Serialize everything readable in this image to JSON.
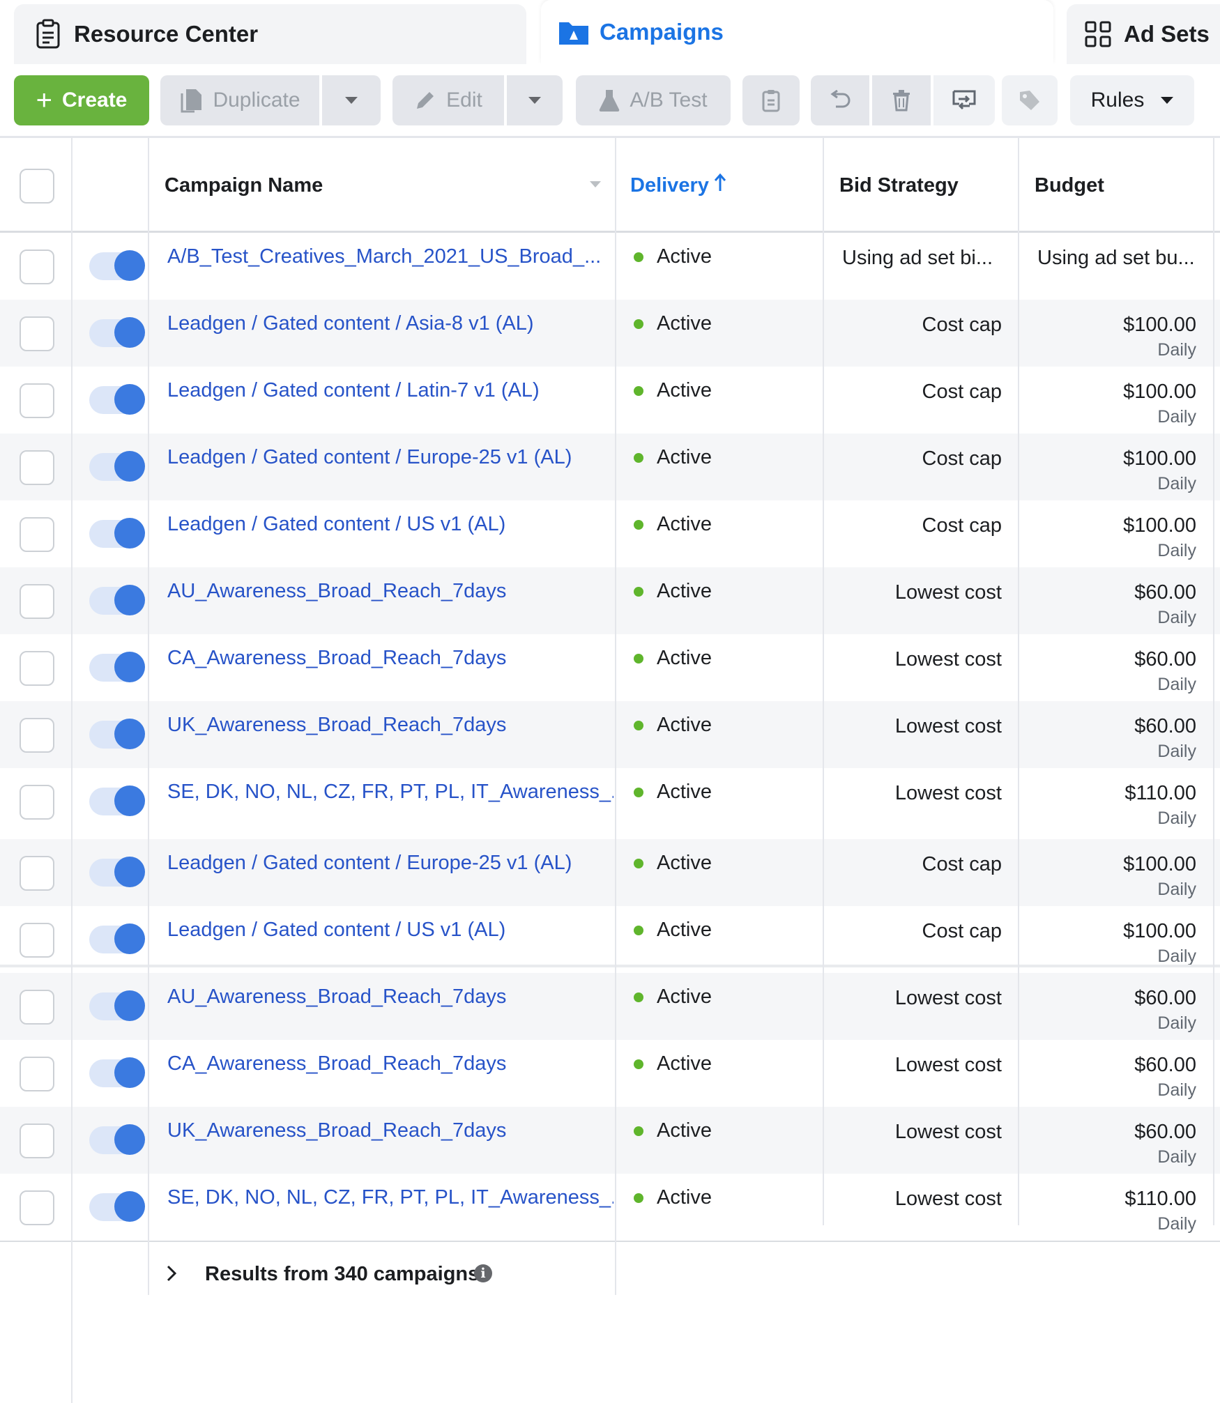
{
  "tabs": [
    {
      "label": "Resource Center",
      "icon": "clipboard-icon"
    },
    {
      "label": "Campaigns",
      "icon": "campaign-folder-icon",
      "active": true
    },
    {
      "label": "Ad Sets",
      "icon": "grid-icon"
    }
  ],
  "toolbar": {
    "create_label": "Create",
    "duplicate_label": "Duplicate",
    "edit_label": "Edit",
    "ab_test_label": "A/B Test",
    "rules_label": "Rules"
  },
  "colors": {
    "accent": "#1b74e4",
    "create_green": "#69b33e",
    "active_dot": "#5fb52c",
    "link_blue": "#2753c8"
  },
  "table": {
    "columns": {
      "name": "Campaign Name",
      "delivery": "Delivery",
      "bid": "Bid Strategy",
      "budget": "Budget"
    },
    "sort": {
      "column": "Delivery",
      "direction": "ascending"
    },
    "rows": [
      {
        "name": "A/B_Test_Creatives_March_2021_US_Broad_...",
        "delivery": "Active",
        "bid": "Using ad set bi...",
        "budget": "Using ad set bu...",
        "period": ""
      },
      {
        "name": "Leadgen / Gated content / Asia-8 v1 (AL)",
        "delivery": "Active",
        "bid": "Cost cap",
        "budget": "$100.00",
        "period": "Daily"
      },
      {
        "name": "Leadgen / Gated content / Latin-7 v1 (AL)",
        "delivery": "Active",
        "bid": "Cost cap",
        "budget": "$100.00",
        "period": "Daily"
      },
      {
        "name": "Leadgen / Gated content / Europe-25 v1 (AL)",
        "delivery": "Active",
        "bid": "Cost cap",
        "budget": "$100.00",
        "period": "Daily"
      },
      {
        "name": "Leadgen / Gated content / US v1 (AL)",
        "delivery": "Active",
        "bid": "Cost cap",
        "budget": "$100.00",
        "period": "Daily"
      },
      {
        "name": "AU_Awareness_Broad_Reach_7days",
        "delivery": "Active",
        "bid": "Lowest cost",
        "budget": "$60.00",
        "period": "Daily"
      },
      {
        "name": "CA_Awareness_Broad_Reach_7days",
        "delivery": "Active",
        "bid": "Lowest cost",
        "budget": "$60.00",
        "period": "Daily"
      },
      {
        "name": "UK_Awareness_Broad_Reach_7days",
        "delivery": "Active",
        "bid": "Lowest cost",
        "budget": "$60.00",
        "period": "Daily"
      },
      {
        "name": "SE, DK, NO, NL, CZ, FR, PT, PL, IT_Awareness_...",
        "delivery": "Active",
        "bid": "Lowest cost",
        "budget": "$110.00",
        "period": "Daily"
      },
      {
        "name": "Leadgen / Gated content / Europe-25 v1 (AL)",
        "delivery": "Active",
        "bid": "Cost cap",
        "budget": "$100.00",
        "period": "Daily"
      },
      {
        "name": "Leadgen / Gated content / US v1 (AL)",
        "delivery": "Active",
        "bid": "Cost cap",
        "budget": "$100.00",
        "period": "Daily"
      },
      {
        "name": "AU_Awareness_Broad_Reach_7days",
        "delivery": "Active",
        "bid": "Lowest cost",
        "budget": "$60.00",
        "period": "Daily"
      },
      {
        "name": "CA_Awareness_Broad_Reach_7days",
        "delivery": "Active",
        "bid": "Lowest cost",
        "budget": "$60.00",
        "period": "Daily"
      },
      {
        "name": "UK_Awareness_Broad_Reach_7days",
        "delivery": "Active",
        "bid": "Lowest cost",
        "budget": "$60.00",
        "period": "Daily"
      },
      {
        "name": "SE, DK, NO, NL, CZ, FR, PT, PL, IT_Awareness_...",
        "delivery": "Active",
        "bid": "Lowest cost",
        "budget": "$110.00",
        "period": "Daily"
      }
    ],
    "footer": {
      "results_label": "Results from 340 campaigns"
    }
  }
}
